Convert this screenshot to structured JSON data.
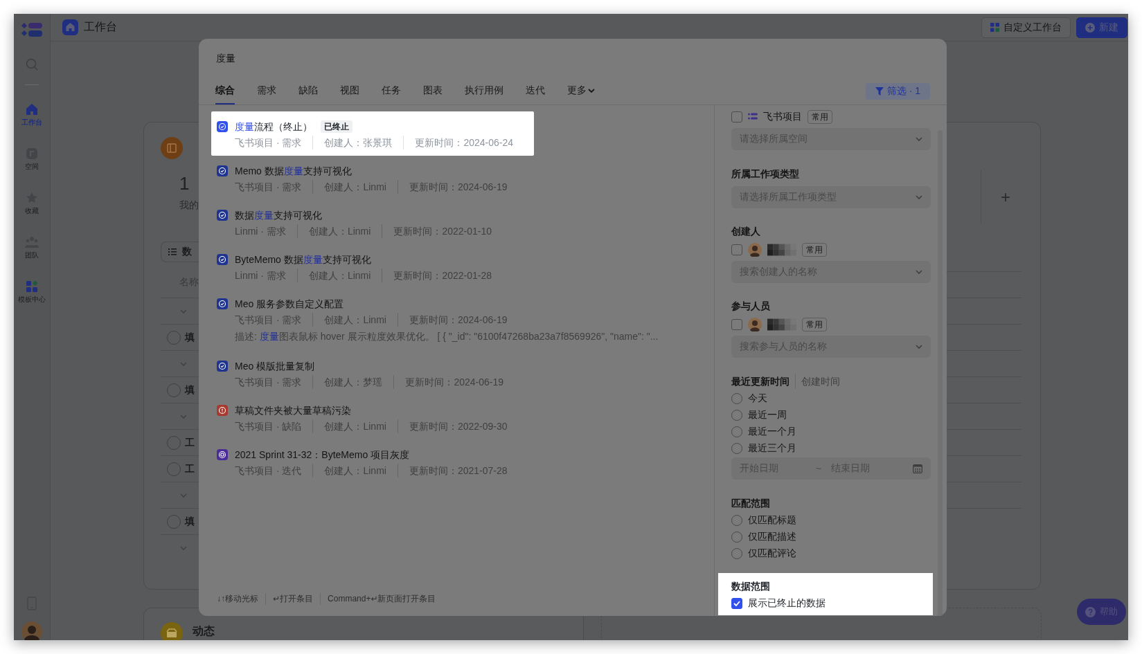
{
  "sidebar": {
    "items": [
      {
        "label": "工作台",
        "kind": "home",
        "selected": true
      },
      {
        "label": "空间",
        "kind": "space",
        "selected": false
      },
      {
        "label": "收藏",
        "kind": "star",
        "selected": false
      },
      {
        "label": "团队",
        "kind": "team",
        "selected": false
      },
      {
        "label": "模板中心",
        "kind": "template",
        "selected": false
      }
    ]
  },
  "header": {
    "title": "工作台",
    "buttons": [
      {
        "label": "自定义工作台",
        "kind": "secondary"
      },
      {
        "label": "新建",
        "kind": "primary"
      }
    ]
  },
  "background": {
    "card_number": "1",
    "card_caption": "我的",
    "toolbar_label": "数",
    "column_label": "名称",
    "add_button": "+",
    "feed_title": "动态",
    "rows": [
      {
        "kind": "group"
      },
      {
        "kind": "task",
        "text": "填",
        "selected": false
      },
      {
        "kind": "group"
      },
      {
        "kind": "task",
        "text": "填",
        "selected": false
      },
      {
        "kind": "group"
      },
      {
        "kind": "task",
        "text": "工",
        "selected": false
      },
      {
        "kind": "task",
        "text": "工",
        "selected": false
      },
      {
        "kind": "group"
      },
      {
        "kind": "task",
        "text": "填",
        "selected": false
      },
      {
        "kind": "group"
      }
    ]
  },
  "help_button": "帮助",
  "modal": {
    "query": "度量",
    "tabs": [
      {
        "label": "综合",
        "selected": true
      },
      {
        "label": "需求",
        "selected": false
      },
      {
        "label": "缺陷",
        "selected": false
      },
      {
        "label": "视图",
        "selected": false
      },
      {
        "label": "任务",
        "selected": false
      },
      {
        "label": "图表",
        "selected": false
      },
      {
        "label": "执行用例",
        "selected": false
      },
      {
        "label": "迭代",
        "selected": false
      },
      {
        "label": "更多",
        "selected": false
      }
    ],
    "filter_button": "筛选 · 1",
    "results": [
      {
        "kind": "requirement",
        "highlighted": true,
        "title": [
          {
            "text": "度量",
            "match": true
          },
          {
            "text": "流程（终止）",
            "match": false
          }
        ],
        "status_tag": "已终止",
        "source": "飞书项目 · 需求",
        "creator": "创建人：张景琪",
        "updated": "更新时间：2024-06-24"
      },
      {
        "kind": "requirement",
        "highlighted": false,
        "title": [
          {
            "text": "Memo 数据",
            "match": false
          },
          {
            "text": "度量",
            "match": true
          },
          {
            "text": "支持可视化",
            "match": false
          }
        ],
        "source": "飞书项目 · 需求",
        "creator": "创建人：Linmi",
        "updated": "更新时间：2024-06-19"
      },
      {
        "kind": "requirement",
        "highlighted": false,
        "title": [
          {
            "text": "数据",
            "match": false
          },
          {
            "text": "度量",
            "match": true
          },
          {
            "text": "支持可视化",
            "match": false
          }
        ],
        "source": "Linmi · 需求",
        "creator": "创建人：Linmi",
        "updated": "更新时间：2022-01-10"
      },
      {
        "kind": "requirement",
        "highlighted": false,
        "title": [
          {
            "text": "ByteMemo 数据",
            "match": false
          },
          {
            "text": "度量",
            "match": true
          },
          {
            "text": "支持可视化",
            "match": false
          }
        ],
        "source": "Linmi · 需求",
        "creator": "创建人：Linmi",
        "updated": "更新时间：2022-01-28"
      },
      {
        "kind": "requirement",
        "highlighted": false,
        "title": [
          {
            "text": "Meo 服务参数自定义配置",
            "match": false
          }
        ],
        "source": "飞书项目 · 需求",
        "creator": "创建人：Linmi",
        "updated": "更新时间：2024-06-19",
        "description": [
          {
            "text": "描述: ",
            "match": false
          },
          {
            "text": "度量",
            "match": true
          },
          {
            "text": "图表鼠标 hover 展示粒度效果优化。 [ { \"_id\": \"6100f47268ba23a7f8569926\", \"name\": \"...",
            "match": false
          }
        ]
      },
      {
        "kind": "requirement",
        "highlighted": false,
        "title": [
          {
            "text": "Meo 模版批量复制",
            "match": false
          }
        ],
        "source": "飞书项目 · 需求",
        "creator": "创建人：梦瑶",
        "updated": "更新时间：2024-06-19"
      },
      {
        "kind": "defect",
        "highlighted": false,
        "title": [
          {
            "text": "草稿文件夹被大量草稿污染",
            "match": false
          }
        ],
        "source": "飞书项目 · 缺陷",
        "creator": "创建人：Linmi",
        "updated": "更新时间：2022-09-30"
      },
      {
        "kind": "iteration",
        "highlighted": false,
        "title": [
          {
            "text": "2021 Sprint 31-32：ByteMemo 项目灰度",
            "match": false
          }
        ],
        "source": "飞书项目 · 迭代",
        "creator": "创建人：Linmi",
        "updated": "更新时间：2021-07-28"
      }
    ],
    "footer_hints": [
      "↓↑移动光标",
      "↵打开条目",
      "Command+↵新页面打开条目"
    ],
    "filters": [
      {
        "kind": "space",
        "checked": false,
        "label": "飞书项目",
        "tag": "常用",
        "placeholder": "请选择所属空间"
      },
      {
        "kind": "select",
        "title": "所属工作项类型",
        "placeholder": "请选择所属工作项类型"
      },
      {
        "kind": "person",
        "title": "创建人",
        "checked": false,
        "tag": "常用",
        "placeholder": "搜索创建人的名称"
      },
      {
        "kind": "person",
        "title": "参与人员",
        "checked": false,
        "tag": "常用",
        "placeholder": "搜索参与人员的名称"
      },
      {
        "kind": "date",
        "tabs": [
          {
            "label": "最近更新时间",
            "selected": true
          },
          {
            "label": "创建时间",
            "selected": false
          }
        ],
        "options": [
          {
            "label": "今天",
            "selected": false
          },
          {
            "label": "最近一周",
            "selected": false
          },
          {
            "label": "最近一个月",
            "selected": false
          },
          {
            "label": "最近三个月",
            "selected": false
          }
        ],
        "start_placeholder": "开始日期",
        "separator": "~",
        "end_placeholder": "结束日期"
      },
      {
        "kind": "radio",
        "title": "匹配范围",
        "options": [
          {
            "label": "仅匹配标题",
            "selected": false
          },
          {
            "label": "仅匹配描述",
            "selected": false
          },
          {
            "label": "仅匹配评论",
            "selected": false
          }
        ]
      },
      {
        "kind": "checkbox",
        "title": "数据范围",
        "highlighted": true,
        "options": [
          {
            "label": "展示已终止的数据",
            "checked": true
          }
        ]
      }
    ]
  }
}
